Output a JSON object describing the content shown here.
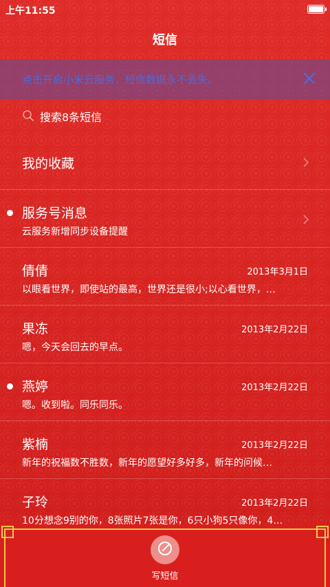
{
  "status": {
    "time": "上午11:55",
    "battery_level": 1.0
  },
  "header": {
    "title": "短信"
  },
  "banner": {
    "text": "点击开启小米云服务，短信数据永不丢失。"
  },
  "search": {
    "placeholder": "搜索8条短信"
  },
  "favorites": {
    "label": "我的收藏"
  },
  "service": {
    "name": "服务号消息",
    "preview": "云服务新增同步设备提醒",
    "unread": true
  },
  "conversations": [
    {
      "name": "倩倩",
      "date": "2013年3月1日",
      "preview": "以眼看世界，即使站的最高，世界还是很小;以心看世界，…",
      "unread": false
    },
    {
      "name": "果冻",
      "date": "2013年2月22日",
      "preview": "嗯，今天会回去的早点。",
      "unread": false
    },
    {
      "name": "燕婷",
      "date": "2013年2月22日",
      "preview": "嗯。收到啦。同乐同乐。",
      "unread": true
    },
    {
      "name": "紫楠",
      "date": "2013年2月22日",
      "preview": "新年的祝福数不胜数，新年的愿望好多好多，新年的问候…",
      "unread": false
    },
    {
      "name": "子玲",
      "date": "2013年2月22日",
      "preview": "10分想念9别的你，8张照片7张是你，6只小狗5只像你，4…",
      "unread": false
    }
  ],
  "compose": {
    "label": "写短信"
  },
  "colors": {
    "background": "#d9211f",
    "banner_text": "#4d6dd9",
    "frame_gold": "#f2c94c"
  },
  "icons": {
    "search": "search-icon",
    "close": "close-icon",
    "chevron": "chevron-right-icon",
    "compose": "compose-icon"
  }
}
